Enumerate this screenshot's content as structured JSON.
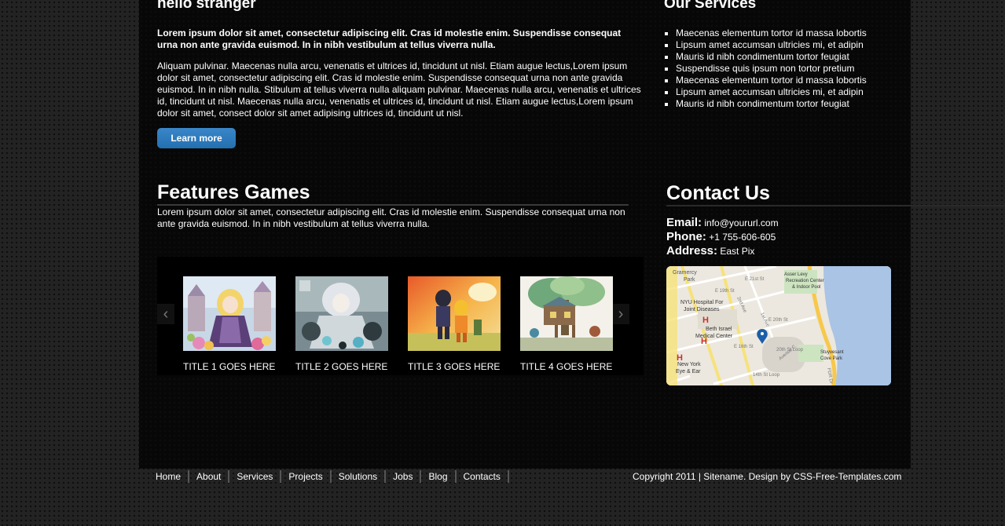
{
  "intro": {
    "title": "hello stranger",
    "bold_text": "Lorem ipsum dolor sit amet, consectetur adipiscing elit. Cras id molestie enim. Suspendisse consequat urna non ante gravida euismod. In in nibh vestibulum at tellus viverra nulla.",
    "body_text": "Aliquam pulvinar. Maecenas nulla arcu, venenatis et ultrices id, tincidunt ut nisl. Etiam augue lectus,Lorem ipsum dolor sit amet, consectetur adipiscing elit. Cras id molestie enim. Suspendisse consequat urna non ante gravida euismod. In in nibh nulla. Stibulum at tellus viverra nulla aliquam pulvinar. Maecenas nulla arcu, venenatis et ultrices id, tincidunt ut nisl. Maecenas nulla arcu, venenatis et ultrices id, tincidunt ut nisl. Etiam augue lectus,Lorem ipsum dolor sit amet, consect dolor sit amet adipising ultrices id, tincidunt ut nisl.",
    "button_label": "Learn more"
  },
  "services": {
    "title": "Our Services",
    "items": [
      "Maecenas elementum tortor id massa lobortis",
      "Lipsum amet accumsan ultricies mi, et adipin",
      "Mauris id nibh condimentum tortor feugiat",
      "Suspendisse quis ipsum non tortor pretium",
      "Maecenas elementum tortor id massa lobortis",
      "Lipsum amet accumsan ultricies mi, et adipin",
      "Mauris id nibh condimentum tortor feugiat"
    ]
  },
  "features": {
    "title": "Features Games",
    "text": "Lorem ipsum dolor sit amet, consectetur adipiscing elit. Cras id molestie enim. Suspendisse consequat urna non ante gravida euismod. In in nibh vestibulum at tellus viverra nulla.",
    "prev_icon": "chevron-left-icon",
    "next_icon": "chevron-right-icon",
    "slides": [
      {
        "caption": "TITLE 1 GOES HERE"
      },
      {
        "caption": "TITLE 2 GOES HERE"
      },
      {
        "caption": "TITLE 3 GOES HERE"
      },
      {
        "caption": "TITLE 4 GOES HERE"
      }
    ]
  },
  "contact": {
    "title": "Contact Us",
    "email_label": "Email:",
    "email_value": "info@yoururl.com",
    "phone_label": "Phone:",
    "phone_value": "+1 755-606-605",
    "address_label": "Address:",
    "address_value": "East Pix",
    "map_labels": {
      "gramercy": "Gramercy",
      "park": "Park",
      "e21": "E 21st St",
      "e19": "E 19th St",
      "asser1": "Asser Levy",
      "asser2": "Recreation Center",
      "asser3": "& Indoor Pool",
      "nyu1": "NYU Hospital For",
      "nyu2": "Joint Diseases",
      "beth1": "Beth Israel",
      "beth2": "Medical Center",
      "e16": "E 16th St",
      "e20": "E 20th St",
      "loop": "20th St Loop",
      "stuy1": "Stuyvesant",
      "stuy2": "Cove Park",
      "nyeye1": "New York",
      "nyeye2": "Eye & Ear",
      "loop14": "14th St Loop",
      "firstave": "1st Ave",
      "secondave": "2nd Ave",
      "avec": "Avenue C",
      "fdr": "FDR Dr"
    }
  },
  "footer": {
    "nav": [
      "Home",
      "About",
      "Services",
      "Projects",
      "Solutions",
      "Jobs",
      "Blog",
      "Contacts"
    ],
    "copyright": "Copyright 2011 | Sitename. Design by CSS-Free-Templates.com"
  },
  "colors": {
    "accent_button": "#2a78bd",
    "page_bg": "#232323",
    "panel_bg": "#070707"
  }
}
